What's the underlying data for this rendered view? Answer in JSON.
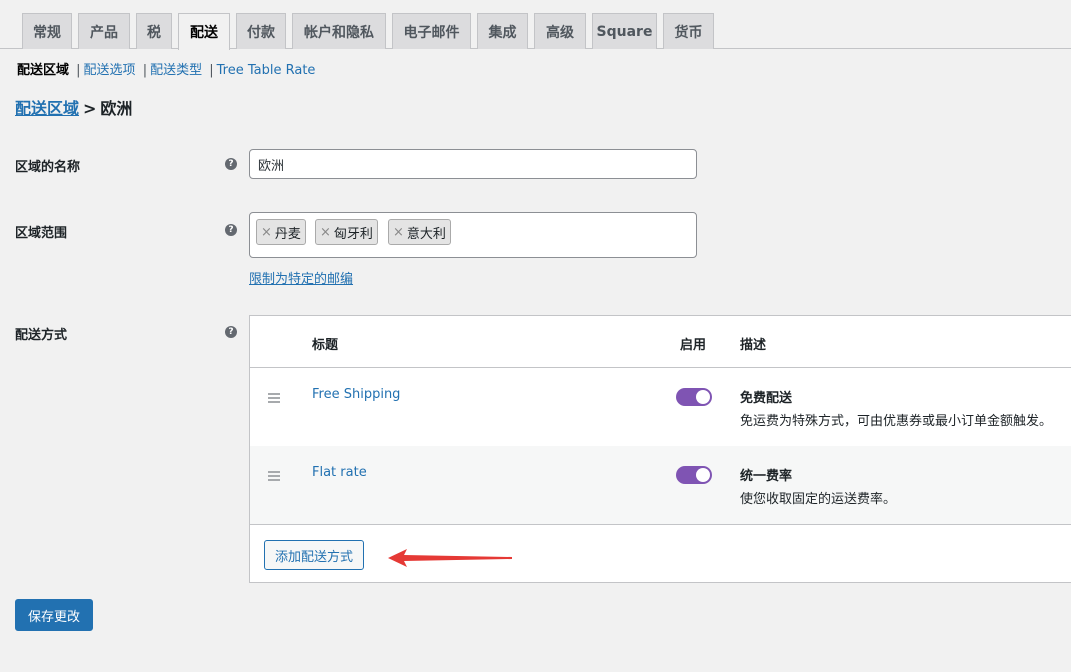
{
  "tabs": [
    "常规",
    "产品",
    "税",
    "配送",
    "付款",
    "帐户和隐私",
    "电子邮件",
    "集成",
    "高级",
    "Square",
    "货币"
  ],
  "active_tab": "配送",
  "subnav": {
    "current": "配送区域",
    "links": [
      "配送选项",
      "配送类型",
      "Tree Table Rate"
    ],
    "separator": "|"
  },
  "breadcrumb": {
    "parent": "配送区域",
    "separator": ">",
    "current": "欧洲"
  },
  "form": {
    "help_glyph": "?",
    "zone_name": {
      "label": "区域的名称",
      "value": "欧洲"
    },
    "zone_regions": {
      "label": "区域范围",
      "chips": [
        "丹麦",
        "匈牙利",
        "意大利"
      ],
      "chip_remove": "×",
      "limit_link": "限制为特定的邮编"
    },
    "methods_label": "配送方式"
  },
  "methods_table": {
    "headers": {
      "title": "标题",
      "enabled": "启用",
      "description": "描述"
    },
    "rows": [
      {
        "name": "Free Shipping",
        "enabled": true,
        "title": "免费配送",
        "desc": "免运费为特殊方式，可由优惠券或最小订单金额触发。"
      },
      {
        "name": "Flat rate",
        "enabled": true,
        "title": "统一费率",
        "desc": "使您收取固定的运送费率。"
      }
    ],
    "add_button": "添加配送方式"
  },
  "save_button": "保存更改",
  "colors": {
    "accent": "#2271b1",
    "toggle_on": "#7f54b3",
    "annotation_arrow": "#e53935"
  },
  "icons": {
    "help": "help-icon",
    "drag": "drag-handle-icon",
    "arrow": "annotation-arrow"
  }
}
